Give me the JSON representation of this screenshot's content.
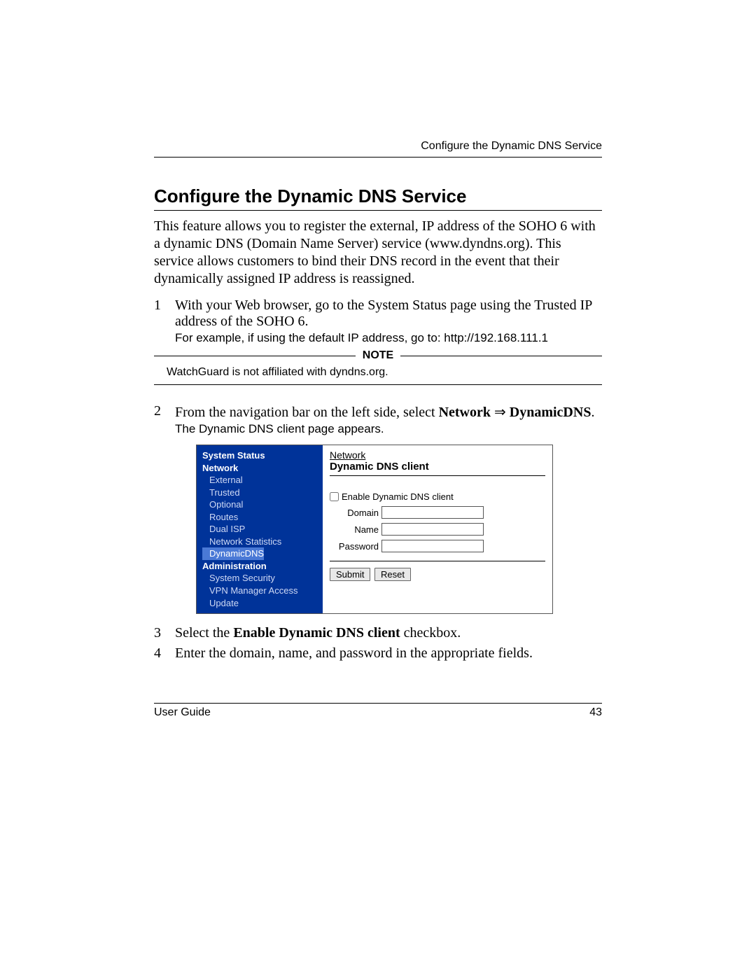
{
  "header": {
    "running_head": "Configure the Dynamic DNS Service"
  },
  "section": {
    "title": "Configure the Dynamic DNS Service",
    "intro": "This feature allows you to register the external, IP address of the SOHO 6 with a dynamic DNS (Domain Name Server) service (www.dyndns.org).  This service allows customers to bind their DNS record in the event that their dynamically assigned IP address is reassigned."
  },
  "steps": {
    "s1_num": "1",
    "s1_text": "With your Web browser, go to the System Status page using the Trusted IP address of the SOHO 6.",
    "s1_code": "For example, if using the default IP address, go to: http://192.168.111.1",
    "note_label": "NOTE",
    "note_body": "WatchGuard is not affiliated with dyndns.org.",
    "s2_num": "2",
    "s2_text_a": "From the navigation bar on the left side, select ",
    "s2_text_b1": "Network",
    "s2_arrow": " ⇒ ",
    "s2_text_b2": "DynamicDNS",
    "s2_text_c": ".",
    "s2_result": "The Dynamic DNS client page appears.",
    "s3_num": "3",
    "s3_text_a": "Select the ",
    "s3_text_b": "Enable Dynamic DNS client",
    "s3_text_c": " checkbox.",
    "s4_num": "4",
    "s4_text": "Enter the domain, name, and password in the appropriate fields."
  },
  "screenshot": {
    "sidebar": {
      "system_status": "System Status",
      "network": "Network",
      "external": "External",
      "trusted": "Trusted",
      "optional": "Optional",
      "routes": "Routes",
      "dual_isp": "Dual ISP",
      "net_stats": "Network Statistics",
      "dynamic_dns": "DynamicDNS",
      "administration": "Administration",
      "system_security": "System Security",
      "vpn_mgr": "VPN Manager Access",
      "update": "Update"
    },
    "pane": {
      "breadcrumb": "Network",
      "title": "Dynamic DNS client",
      "checkbox_label": "Enable Dynamic DNS client",
      "domain_label": "Domain",
      "name_label": "Name",
      "password_label": "Password",
      "submit": "Submit",
      "reset": "Reset"
    }
  },
  "footer": {
    "left": "User Guide",
    "right": "43"
  }
}
